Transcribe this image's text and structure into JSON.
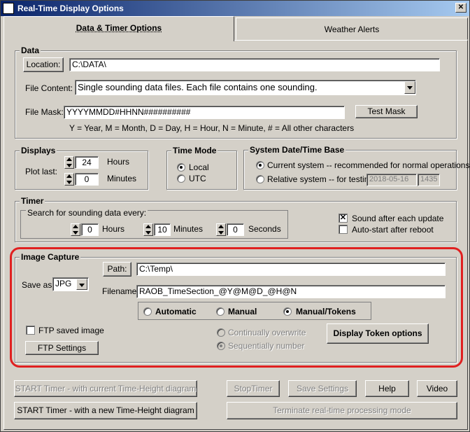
{
  "window": {
    "title": "Real-Time Display Options"
  },
  "tabs": [
    {
      "label": "Data & Timer Options"
    },
    {
      "label": "Weather Alerts"
    }
  ],
  "data_group": {
    "title": "Data",
    "location_button": "Location:",
    "location_value": "C:\\DATA\\",
    "file_content_label": "File Content:",
    "file_content_value": "Single sounding data files.  Each file contains one sounding.",
    "file_mask_label": "File Mask:",
    "file_mask_value": "YYYYMMDD#HHNN##########",
    "test_mask_button": "Test Mask",
    "mask_legend": "Y = Year,  M = Month,  D = Day,  H = Hour,  N = Minute,   # = All other characters"
  },
  "displays_group": {
    "title": "Displays",
    "plot_last_label": "Plot last:",
    "hours_value": "24",
    "hours_label": "Hours",
    "minutes_value": "0",
    "minutes_label": "Minutes"
  },
  "time_mode_group": {
    "title": "Time Mode",
    "local_label": "Local",
    "utc_label": "UTC",
    "selected": "Local"
  },
  "system_date_group": {
    "title": "System Date/Time Base",
    "current_label": "Current system -- recommended for normal operations",
    "relative_label": "Relative system -- for testing:",
    "relative_date": "2018-05-16",
    "relative_time": "1435"
  },
  "timer_group": {
    "title": "Timer",
    "search_label": "Search for sounding data every:",
    "hours_value": "0",
    "hours_label": "Hours",
    "minutes_value": "10",
    "minutes_label": "Minutes",
    "seconds_value": "0",
    "seconds_label": "Seconds",
    "sound_label": "Sound after each update",
    "sound_checked": true,
    "autostart_label": "Auto-start after reboot",
    "autostart_checked": false
  },
  "image_capture": {
    "title": "Image Capture",
    "path_button": "Path:",
    "path_value": "C:\\Temp\\",
    "save_as_label": "Save as:",
    "save_as_value": "JPG",
    "filename_label": "Filename:",
    "filename_value": "RAOB_TimeSection_@Y@M@D_@H@N",
    "mode_automatic": "Automatic",
    "mode_manual": "Manual",
    "mode_manual_tokens": "Manual/Tokens",
    "mode_selected": "Manual/Tokens",
    "ftp_saved_label": "FTP saved image",
    "ftp_settings_button": "FTP Settings",
    "continually_overwrite": "Continually overwrite",
    "sequentially_number": "Sequentially number",
    "display_token_button": "Display Token options"
  },
  "bottom_buttons": {
    "start_current": "START Timer - with current Time-Height diagram",
    "start_new": "START Timer - with a new Time-Height diagram",
    "stop_timer": "StopTimer",
    "save_settings": "Save Settings",
    "help": "Help",
    "video": "Video",
    "terminate": "Terminate real-time processing mode"
  },
  "colors": {
    "title_bar": "#0a246a",
    "highlight_ring": "#e02020",
    "face": "#d4d0c8"
  }
}
